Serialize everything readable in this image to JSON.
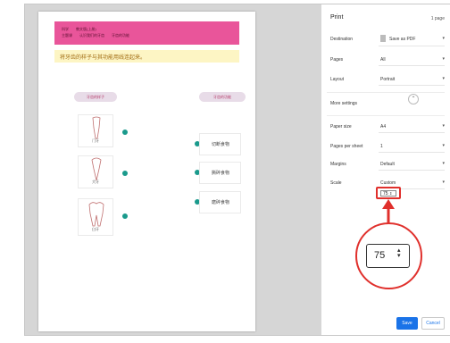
{
  "worksheet": {
    "header_line1": "科学　　教文版(上册)",
    "header_line2": "主题课　　认识我们的牙齿　　牙齿的功能",
    "instruction": "将牙齿的样子与其功能用线连起来。",
    "left_pill": "牙齿的样子",
    "right_pill": "牙齿的功能",
    "teeth": [
      {
        "label": "门牙"
      },
      {
        "label": "犬牙"
      },
      {
        "label": "臼牙"
      }
    ],
    "functions": [
      {
        "label": "切断食物"
      },
      {
        "label": "撕碎食物"
      },
      {
        "label": "磨碎食物"
      }
    ]
  },
  "print": {
    "title": "Print",
    "page_count": "1 page",
    "destination_label": "Destination",
    "destination_value": "Save as PDF",
    "pages_label": "Pages",
    "pages_value": "All",
    "layout_label": "Layout",
    "layout_value": "Portrait",
    "more_settings_label": "More settings",
    "paper_size_label": "Paper size",
    "paper_size_value": "A4",
    "pages_per_sheet_label": "Pages per sheet",
    "pages_per_sheet_value": "1",
    "margins_label": "Margins",
    "margins_value": "Default",
    "scale_label": "Scale",
    "scale_value": "Custom",
    "scale_number": "75",
    "save_label": "Save",
    "cancel_label": "Cancel"
  },
  "colors": {
    "highlight": "#e0302c",
    "banner": "#e9559a",
    "accent": "#1a73e8",
    "dot": "#1a9a8c"
  }
}
